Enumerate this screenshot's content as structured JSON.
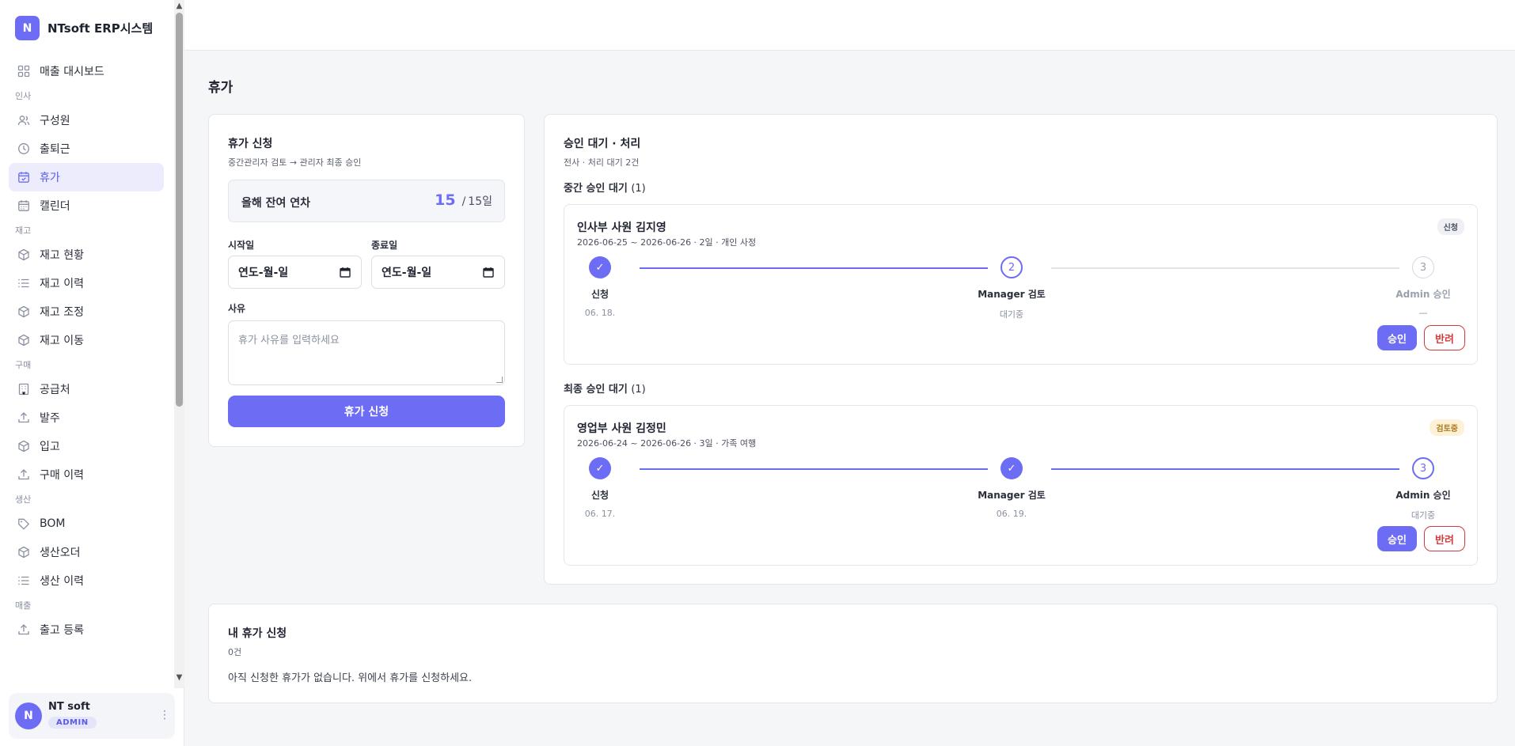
{
  "brand": {
    "logo_letter": "N",
    "name": "NTsoft ERP시스템"
  },
  "sidebar": {
    "items": [
      {
        "type": "item",
        "label": "매출 대시보드",
        "icon": "dashboard-icon",
        "active": false
      },
      {
        "type": "section",
        "label": "인사"
      },
      {
        "type": "item",
        "label": "구성원",
        "icon": "users-icon",
        "active": false
      },
      {
        "type": "item",
        "label": "출퇴근",
        "icon": "clock-icon",
        "active": false
      },
      {
        "type": "item",
        "label": "휴가",
        "icon": "calendar-check-icon",
        "active": true
      },
      {
        "type": "item",
        "label": "캘린더",
        "icon": "calendar-icon",
        "active": false
      },
      {
        "type": "section",
        "label": "재고"
      },
      {
        "type": "item",
        "label": "재고 현황",
        "icon": "box-icon",
        "active": false
      },
      {
        "type": "item",
        "label": "재고 이력",
        "icon": "list-icon",
        "active": false
      },
      {
        "type": "item",
        "label": "재고 조정",
        "icon": "box-icon",
        "active": false
      },
      {
        "type": "item",
        "label": "재고 이동",
        "icon": "box-icon",
        "active": false
      },
      {
        "type": "section",
        "label": "구매"
      },
      {
        "type": "item",
        "label": "공급처",
        "icon": "building-icon",
        "active": false
      },
      {
        "type": "item",
        "label": "발주",
        "icon": "upload-icon",
        "active": false
      },
      {
        "type": "item",
        "label": "입고",
        "icon": "box-icon",
        "active": false
      },
      {
        "type": "item",
        "label": "구매 이력",
        "icon": "upload-icon",
        "active": false
      },
      {
        "type": "section",
        "label": "생산"
      },
      {
        "type": "item",
        "label": "BOM",
        "icon": "tag-icon",
        "active": false
      },
      {
        "type": "item",
        "label": "생산오더",
        "icon": "box-icon",
        "active": false
      },
      {
        "type": "item",
        "label": "생산 이력",
        "icon": "list-icon",
        "active": false
      },
      {
        "type": "section",
        "label": "매출"
      },
      {
        "type": "item",
        "label": "출고 등록",
        "icon": "upload-icon",
        "active": false
      }
    ]
  },
  "user": {
    "avatar_letter": "N",
    "name": "NT soft",
    "role": "ADMIN"
  },
  "page": {
    "title": "휴가"
  },
  "request": {
    "title": "휴가 신청",
    "subtitle": "중간관리자 검토 → 관리자 최종 승인",
    "balance_label": "올해 잔여 연차",
    "balance_value": "15",
    "balance_sep": "/",
    "balance_total": "15일",
    "start_label": "시작일",
    "end_label": "종료일",
    "date_placeholder": "연도-월-일",
    "reason_label": "사유",
    "reason_placeholder": "휴가 사유를 입력하세요",
    "submit_label": "휴가 신청"
  },
  "approval": {
    "title": "승인 대기 · 처리",
    "subtitle": "전사 · 처리 대기 2건",
    "mid_label": "중간 승인 대기",
    "mid_count": "(1)",
    "final_label": "최종 승인 대기",
    "final_count": "(1)",
    "approve_label": "승인",
    "reject_label": "반려",
    "items": [
      {
        "title": "인사부 사원 김지영",
        "detail": "2026-06-25 ~ 2026-06-26 · 2일 · 개인 사정",
        "badge": "신청",
        "steps": [
          {
            "mark": "✓",
            "name": "신청",
            "date": "06. 18."
          },
          {
            "mark": "2",
            "name": "Manager 검토",
            "date": "대기중"
          },
          {
            "mark": "3",
            "name": "Admin 승인",
            "date": "—"
          }
        ]
      },
      {
        "title": "영업부 사원 김정민",
        "detail": "2026-06-24 ~ 2026-06-26 · 3일 · 가족 여행",
        "badge": "검토중",
        "steps": [
          {
            "mark": "✓",
            "name": "신청",
            "date": "06. 17."
          },
          {
            "mark": "✓",
            "name": "Manager 검토",
            "date": "06. 19."
          },
          {
            "mark": "3",
            "name": "Admin 승인",
            "date": "대기중"
          }
        ]
      }
    ]
  },
  "mine": {
    "title": "내 휴가 신청",
    "count": "0건",
    "empty": "아직 신청한 휴가가 없습니다. 위에서 휴가를 신청하세요."
  },
  "colors": {
    "accent": "#6c6cf5",
    "reject": "#d23c3c"
  }
}
